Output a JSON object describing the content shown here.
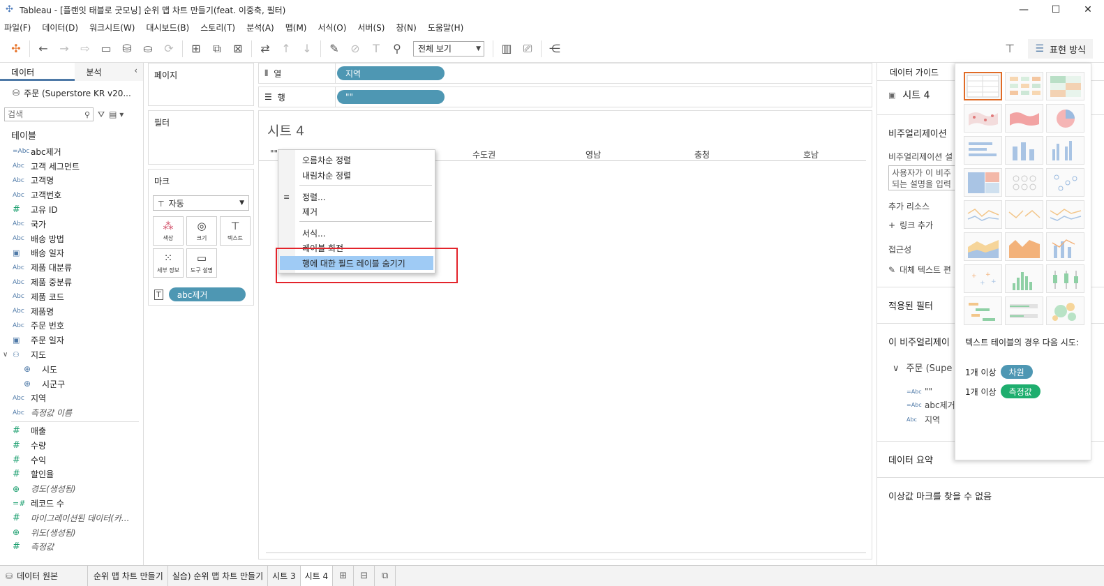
{
  "window": {
    "title": "Tableau - [플랜잇 태블로 굿모닝] 순위 맵 차트 만들기(feat. 이중축, 필터)",
    "controls": [
      "—",
      "☐",
      "✕"
    ]
  },
  "menu": [
    "파일(F)",
    "데이터(D)",
    "워크시트(W)",
    "대시보드(B)",
    "스토리(T)",
    "분석(A)",
    "맵(M)",
    "서식(O)",
    "서버(S)",
    "창(N)",
    "도움말(H)"
  ],
  "toolbar": {
    "fit_select": "전체 보기",
    "show_me_label": "표현 방식"
  },
  "left_pane": {
    "tab_data": "데이터",
    "tab_analysis": "분석",
    "datasource": "주문 (Superstore KR v20...",
    "search_placeholder": "검색",
    "tables_label": "테이블",
    "fields": [
      {
        "type": "=Abc",
        "name": "abc제거"
      },
      {
        "type": "Abc",
        "name": "고객 세그먼트"
      },
      {
        "type": "Abc",
        "name": "고객명"
      },
      {
        "type": "Abc",
        "name": "고객번호"
      },
      {
        "type": "#",
        "name": "고유 ID"
      },
      {
        "type": "Abc",
        "name": "국가"
      },
      {
        "type": "Abc",
        "name": "배송 방법"
      },
      {
        "type": "date",
        "name": "배송 일자"
      },
      {
        "type": "Abc",
        "name": "제품 대분류"
      },
      {
        "type": "Abc",
        "name": "제품 중분류"
      },
      {
        "type": "Abc",
        "name": "제품 코드"
      },
      {
        "type": "Abc",
        "name": "제품명"
      },
      {
        "type": "Abc",
        "name": "주문 번호"
      },
      {
        "type": "date",
        "name": "주문 일자"
      }
    ],
    "geo_group": "지도",
    "geo_fields": [
      "시도",
      "시군구"
    ],
    "fields_after_geo": [
      {
        "type": "Abc",
        "name": "지역",
        "italic": false
      },
      {
        "type": "Abc",
        "name": "측정값 이름",
        "italic": true
      }
    ],
    "measures": [
      {
        "type": "#",
        "name": "매출",
        "italic": false
      },
      {
        "type": "#",
        "name": "수량",
        "italic": false
      },
      {
        "type": "#",
        "name": "수익",
        "italic": false
      },
      {
        "type": "#",
        "name": "할인율",
        "italic": false
      },
      {
        "type": "globe",
        "name": "경도(생성됨)",
        "italic": true
      },
      {
        "type": "=#",
        "name": "레코드 수",
        "italic": false
      },
      {
        "type": "#",
        "name": "마이그레이션된 데이터(카...",
        "italic": true
      },
      {
        "type": "globe",
        "name": "위도(생성됨)",
        "italic": true
      },
      {
        "type": "#",
        "name": "측정값",
        "italic": true
      }
    ]
  },
  "cards": {
    "pages": "페이지",
    "filters": "필터",
    "marks": "마크",
    "marks_type": "자동",
    "mark_buttons": [
      "색상",
      "크기",
      "텍스트",
      "세부 정보",
      "도구 설명"
    ],
    "mark_pill": "abc제거"
  },
  "shelves": {
    "columns_label": "열",
    "columns_pill": "지역",
    "rows_label": "행",
    "rows_pill": "\"\""
  },
  "view": {
    "sheet_title": "시트 4",
    "row_header_stub": "\"\"",
    "column_headers": [
      "수도권",
      "영남",
      "충청",
      "호남"
    ]
  },
  "context_menu": {
    "items": [
      "오름차순 정렬",
      "내림차순 정렬",
      "정렬...",
      "제거",
      "서식...",
      "레이블 회전",
      "행에 대한 필드 레이블 숨기기"
    ],
    "highlighted_index": 6
  },
  "data_guide": {
    "header": "데이터 가이드",
    "sheet": "시트 4",
    "viz_section": "비주얼리제이션",
    "viz_desc_label": "비주얼리제이션 설",
    "desc_placeholder_1": "사용자가 이 비주",
    "desc_placeholder_2": "되는 설명을 입력",
    "extra_resources": "추가 리소스",
    "add_link": "링크 추가",
    "accessibility": "접근성",
    "alt_text": "대체 텍스트 편",
    "applied_filters": "적용된 필터",
    "this_viz": "이 비주얼리제이",
    "source": "주문 (Supe",
    "source_fields": [
      {
        "type": "=Abc",
        "name": "\"\""
      },
      {
        "type": "=Abc",
        "name": "abc제거"
      },
      {
        "type": "Abc",
        "name": "지역"
      }
    ],
    "data_summary": "데이터 요약",
    "outliers": "이상값 마크를 찾을 수 없음"
  },
  "show_me": {
    "hint": "텍스트 테이블의 경우 다음 시도:",
    "req1_prefix": "1개 이상",
    "req1_tag": "차원",
    "req2_prefix": "1개 이상",
    "req2_tag": "측정값",
    "dimension_color": "#4e97b3",
    "measure_color": "#1eae6e",
    "selected_color": "#e06b26"
  },
  "bottom_tabs": {
    "datasource_tab": "데이터 원본",
    "sheets": [
      "순위 맵 차트 만들기",
      "실습) 순위 맵 차트 만들기",
      "시트 3",
      "시트 4"
    ],
    "active": "시트 4"
  }
}
